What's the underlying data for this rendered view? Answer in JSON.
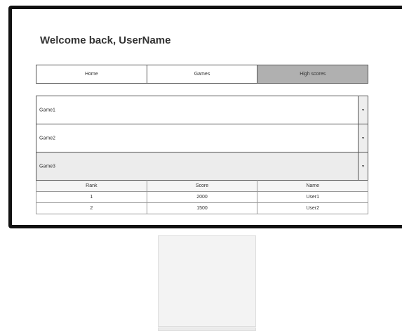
{
  "welcome": {
    "title": "Welcome back, UserName"
  },
  "nav": {
    "tabs": [
      {
        "label": "Home",
        "active": false
      },
      {
        "label": "Games",
        "active": false
      },
      {
        "label": "High scores",
        "active": true
      }
    ]
  },
  "games": [
    {
      "label": "Game1",
      "expanded": false
    },
    {
      "label": "Game2",
      "expanded": false
    },
    {
      "label": "Game3",
      "expanded": true
    }
  ],
  "high_scores": {
    "columns": [
      "Rank",
      "Score",
      "Name"
    ],
    "rows": [
      [
        "1",
        "2000",
        "User1"
      ],
      [
        "2",
        "1500",
        "User2"
      ]
    ]
  },
  "icons": {
    "dropdown": "caret-down-icon"
  },
  "colors": {
    "active_tab": "#b0b0b0",
    "selected_row": "#ececec",
    "frame": "#111111"
  }
}
